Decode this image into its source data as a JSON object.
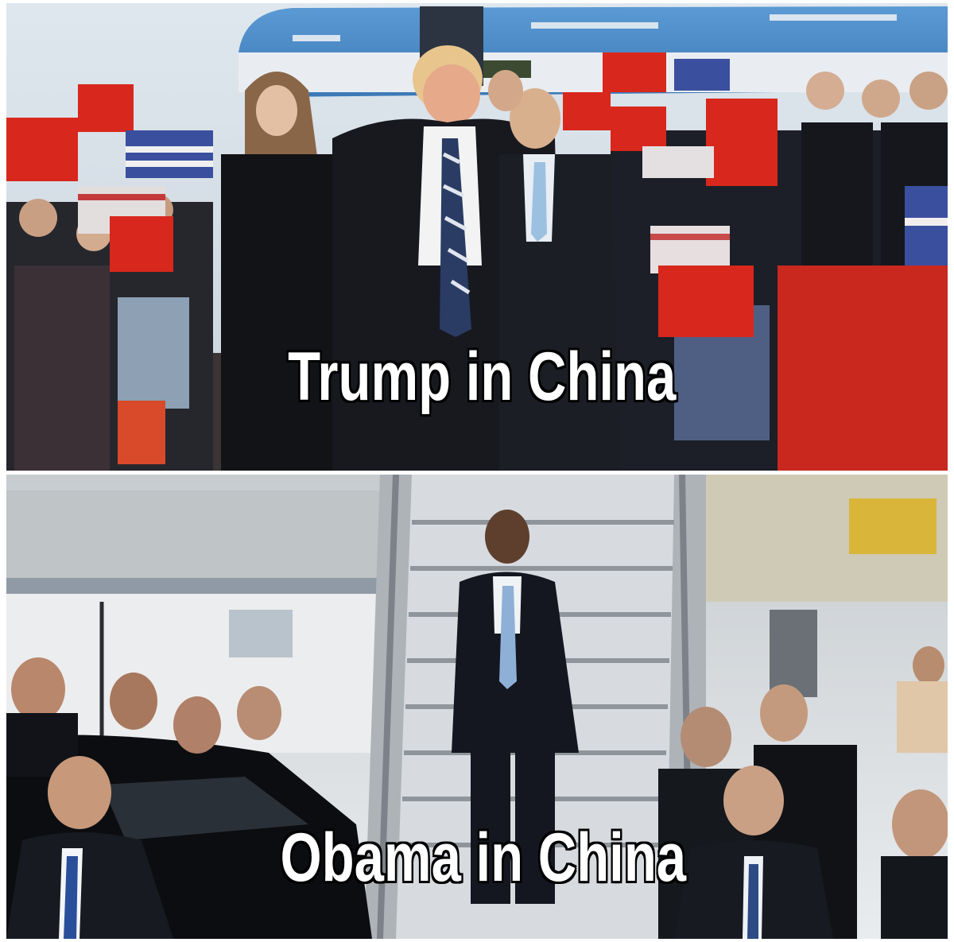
{
  "top_panel": {
    "caption": "Trump in China",
    "colors": {
      "china_red": "#d8271c",
      "us_blue": "#3a4f9e",
      "plane_blue": "#4f8fc8"
    }
  },
  "bottom_panel": {
    "caption": "Obama in China",
    "colors": {
      "stairs": "#d7dbe0",
      "suit": "#14171f",
      "tie": "#8fb0d6"
    }
  }
}
